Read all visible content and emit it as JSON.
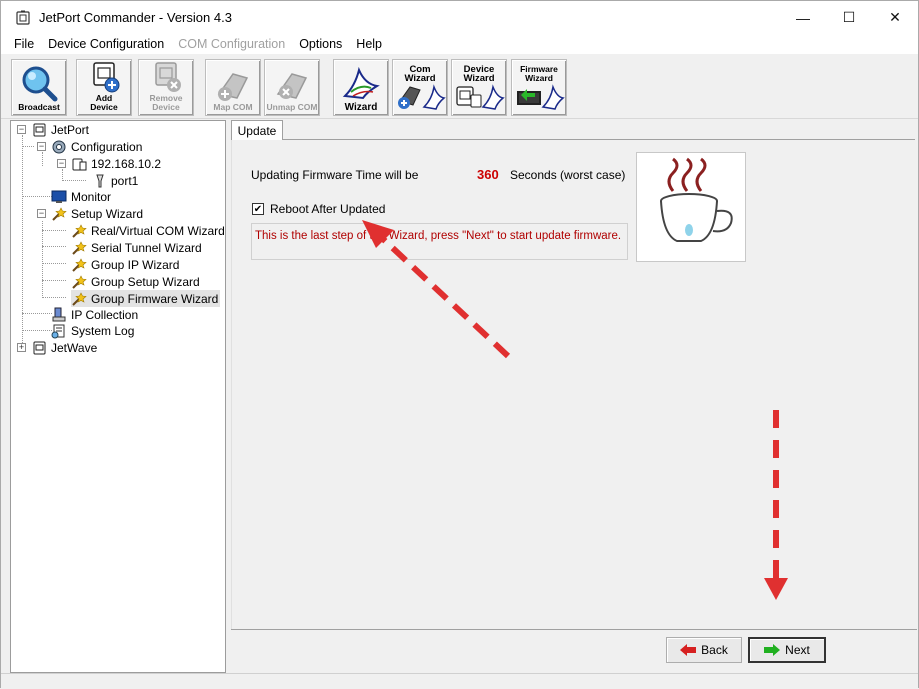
{
  "window": {
    "title": "JetPort Commander - Version 4.3",
    "controls": {
      "minimize": "—",
      "maximize": "☐",
      "close": "✕"
    }
  },
  "menu": {
    "items": [
      {
        "label": "File",
        "enabled": true
      },
      {
        "label": "Device Configuration",
        "enabled": true
      },
      {
        "label": "COM Configuration",
        "enabled": false
      },
      {
        "label": "Options",
        "enabled": true
      },
      {
        "label": "Help",
        "enabled": true
      }
    ]
  },
  "toolbar": {
    "broadcast": {
      "label": "Broadcast",
      "icon": "magnifier-icon"
    },
    "add_device": {
      "label1": "Add",
      "label2": "Device",
      "icon": "add-device-icon"
    },
    "remove_device": {
      "label1": "Remove",
      "label2": "Device",
      "icon": "remove-device-icon",
      "enabled": false
    },
    "map_com": {
      "label": "Map COM",
      "icon": "map-com-icon",
      "enabled": false
    },
    "unmap_com": {
      "label": "Unmap COM",
      "icon": "unmap-com-icon",
      "enabled": false
    },
    "wizard": {
      "label": "Wizard",
      "icon": "wizard-hat-icon"
    },
    "com_wizard": {
      "label1": "Com",
      "label2": "Wizard",
      "icon": "com-wizard-icon"
    },
    "device_wizard": {
      "label1": "Device",
      "label2": "Wizard",
      "icon": "device-wizard-icon"
    },
    "firmware_wizard": {
      "label1": "Firmware",
      "label2": "Wizard",
      "icon": "firmware-wizard-icon"
    }
  },
  "tree": {
    "root": "JetPort",
    "configuration": "Configuration",
    "ip": "192.168.10.2",
    "port": "port1",
    "monitor": "Monitor",
    "setup_wizard": "Setup Wizard",
    "wizards": [
      "Real/Virtual COM Wizard",
      "Serial Tunnel Wizard",
      "Group IP Wizard",
      "Group Setup Wizard",
      "Group Firmware Wizard"
    ],
    "ip_collection": "IP Collection",
    "system_log": "System Log",
    "jetwave": "JetWave"
  },
  "update": {
    "tab_label": "Update",
    "time_label": "Updating Firmware Time will be",
    "seconds_value": "360",
    "seconds_suffix": "Seconds (worst case)",
    "reboot_label": "Reboot After Updated",
    "reboot_checked": true,
    "message": "This is the last step of the Wizard, press \"Next\" to start update firmware.",
    "icon": "coffee-cup-icon"
  },
  "buttons": {
    "back": "Back",
    "next": "Next"
  },
  "colors": {
    "accent_red": "#cc0000",
    "message_red": "#b00000",
    "annotation_arrow": "#e03030"
  }
}
